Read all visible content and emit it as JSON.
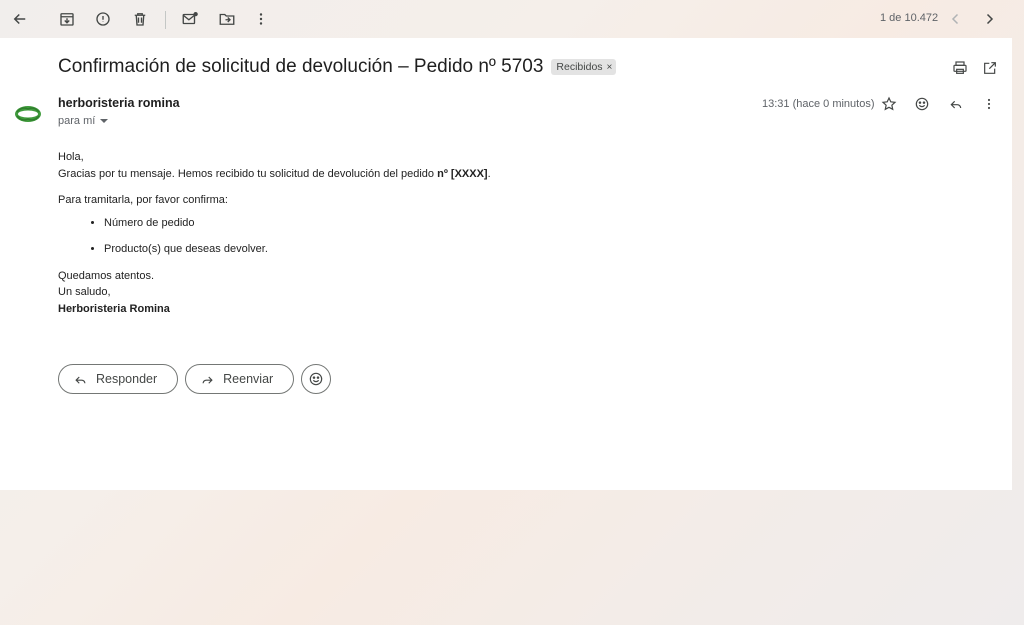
{
  "pager": {
    "text": "1 de 10.472"
  },
  "email": {
    "subject": "Confirmación de solicitud de devolución – Pedido nº 5703",
    "label": "Recibidos",
    "label_remove": "×",
    "sender": "herboristeria romina",
    "recipient": "para mí",
    "time": "13:31 (hace 0 minutos)"
  },
  "body": {
    "greeting": "Hola,",
    "line1": "Gracias por tu mensaje. Hemos recibido tu solicitud de devolución del pedido ",
    "line1_bold": "nº [XXXX]",
    "line1_end": ".",
    "line2": "Para tramitarla, por favor confirma:",
    "bullets": [
      "Número de pedido",
      "Producto(s) que deseas devolver."
    ],
    "closing1": "Quedamos atentos.",
    "closing2": "Un saludo,",
    "signature": "Herboristeria Romina"
  },
  "actions": {
    "reply": "Responder",
    "forward": "Reenviar"
  },
  "icons": {
    "back": "arrow-left-icon",
    "archive": "archive-icon",
    "spam": "report-spam-icon",
    "delete": "trash-icon",
    "unread": "mark-unread-icon",
    "move": "move-to-folder-icon",
    "more": "more-vert-icon",
    "prev": "chevron-left-icon",
    "next": "chevron-right-icon",
    "print": "print-icon",
    "popout": "open-in-new-icon",
    "star": "star-icon",
    "emoji": "emoji-icon",
    "reply": "reply-icon",
    "forward": "forward-icon"
  }
}
